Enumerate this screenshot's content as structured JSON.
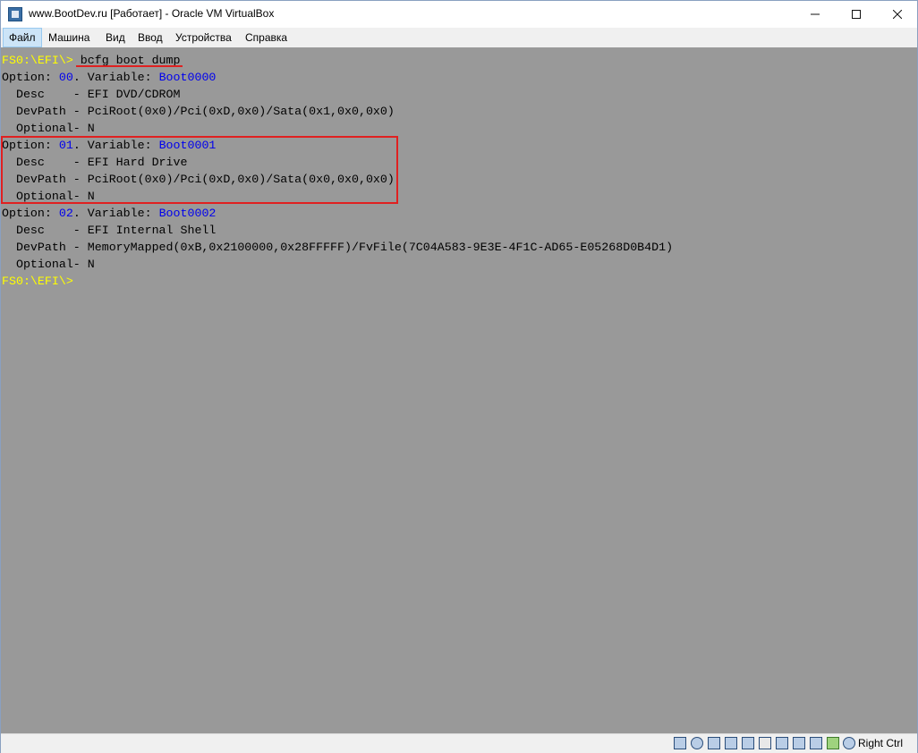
{
  "window": {
    "title": "www.BootDev.ru [Работает] - Oracle VM VirtualBox",
    "controls": {
      "minimize": "—",
      "maximize": "☐",
      "close": "✕"
    }
  },
  "menu": {
    "items": [
      "Файл",
      "Машина",
      "Вид",
      "Ввод",
      "Устройства",
      "Справка"
    ]
  },
  "console": {
    "prompt": "FS0:\\EFI\\>",
    "command": "bcfg boot dump",
    "options": [
      {
        "label": "Option: ",
        "number": "00",
        "variable_label": ". Variable: ",
        "variable": "Boot0000",
        "desc_line": "  Desc    - EFI DVD/CDROM",
        "devpath_line": "  DevPath - PciRoot(0x0)/Pci(0xD,0x0)/Sata(0x1,0x0,0x0)",
        "optional_line": "  Optional- N"
      },
      {
        "label": "Option: ",
        "number": "01",
        "variable_label": ". Variable: ",
        "variable": "Boot0001",
        "desc_line": "  Desc    - EFI Hard Drive",
        "devpath_line": "  DevPath - PciRoot(0x0)/Pci(0xD,0x0)/Sata(0x0,0x0,0x0)",
        "optional_line": "  Optional- N"
      },
      {
        "label": "Option: ",
        "number": "02",
        "variable_label": ". Variable: ",
        "variable": "Boot0002",
        "desc_line": "  Desc    - EFI Internal Shell",
        "devpath_line": "  DevPath - MemoryMapped(0xB,0x2100000,0x28FFFFF)/FvFile(7C04A583-9E3E-4F1C-AD65-E05268D0B4D1)",
        "optional_line": "  Optional- N"
      }
    ],
    "final_prompt": "FS0:\\EFI\\>"
  },
  "status": {
    "host_key": "Right Ctrl",
    "icons": [
      "hard-disk-icon",
      "optical-drive-icon",
      "audio-icon",
      "network-icon",
      "usb-icon",
      "shared-folders-icon",
      "display-icon",
      "video-capture-icon",
      "cpu-icon",
      "mouse-integration-icon",
      "keyboard-icon"
    ]
  },
  "colors": {
    "console_bg": "#999999",
    "prompt": "#ffff00",
    "highlight": "#0000ee",
    "annotation": "#e02020"
  }
}
